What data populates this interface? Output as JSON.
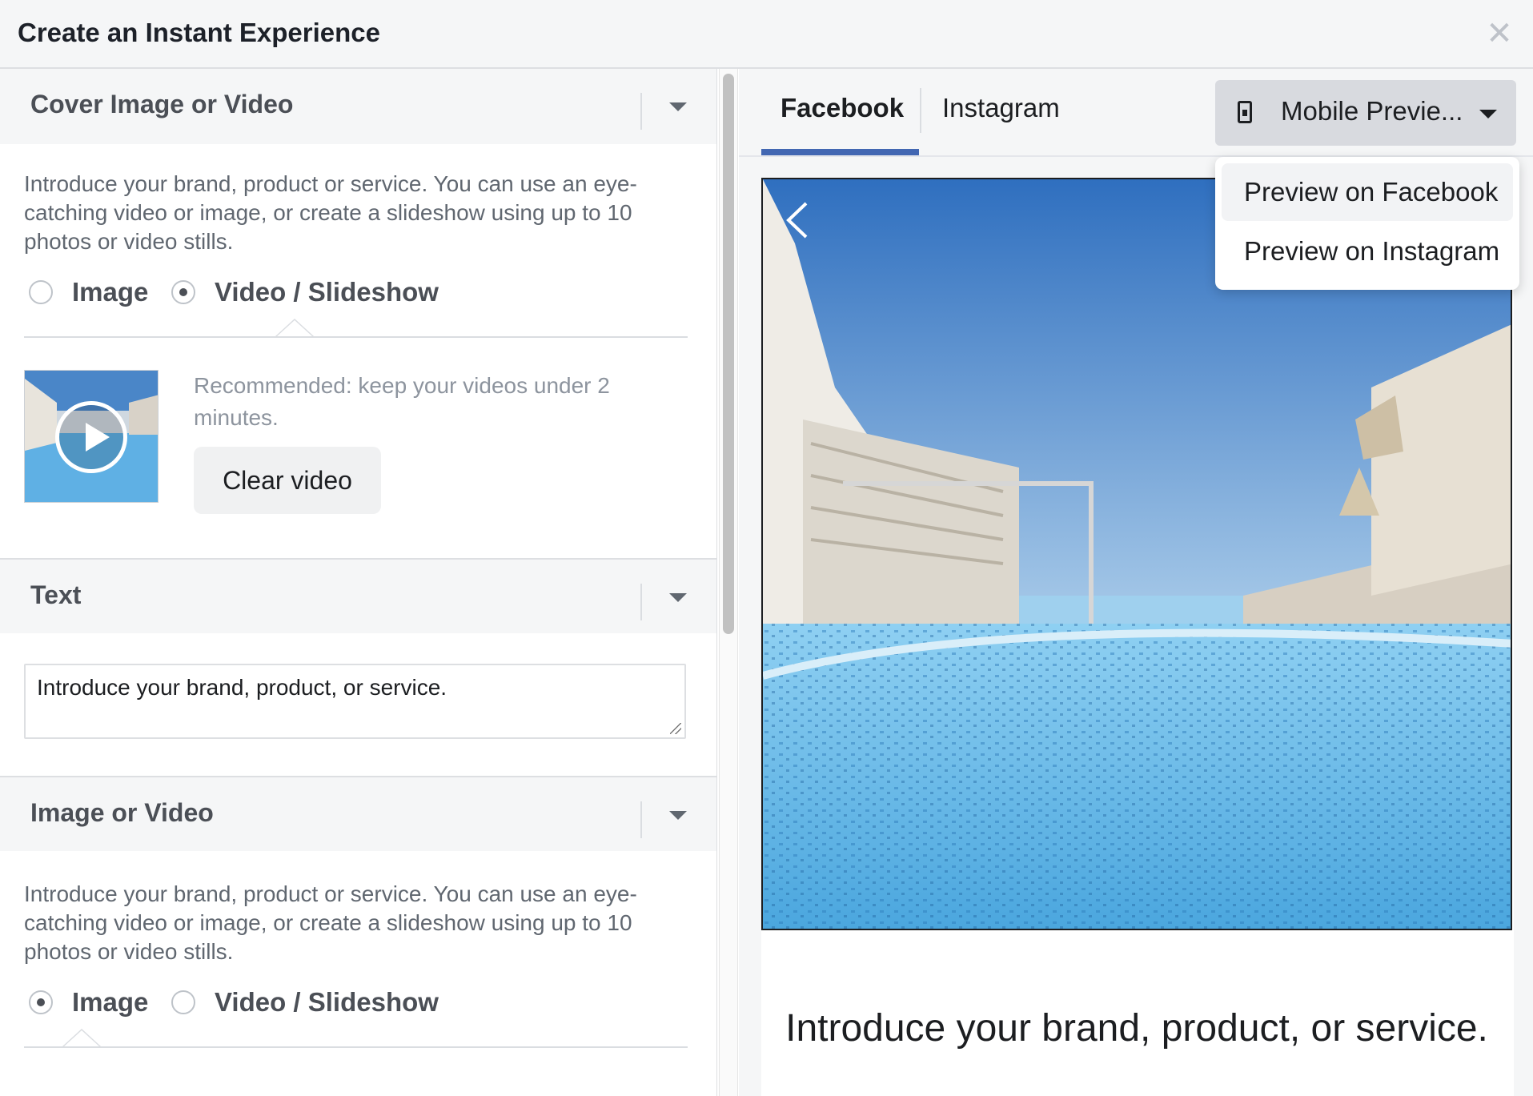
{
  "window": {
    "title": "Create an Instant Experience",
    "close_icon": "close-icon"
  },
  "left_panel": {
    "cover_section": {
      "title": "Cover Image or Video",
      "description": "Introduce your brand, product or service. You can use an eye-catching video or image, or create a slideshow using up to 10 photos or video stills.",
      "options": [
        "Image",
        "Video / Slideshow"
      ],
      "selected": "Video / Slideshow",
      "recommendation": "Recommended: keep your videos under 2 minutes.",
      "clear_button": "Clear video"
    },
    "text_section": {
      "title": "Text",
      "value": "Introduce your brand, product, or service."
    },
    "image_video_section": {
      "title": "Image or Video",
      "description": "Introduce your brand, product or service. You can use an eye-catching video or image, or create a slideshow using up to 10 photos or video stills.",
      "options": [
        "Image",
        "Video / Slideshow"
      ],
      "selected": "Image"
    }
  },
  "right_panel": {
    "tabs": [
      "Facebook",
      "Instagram"
    ],
    "active_tab": "Facebook",
    "preview_button": "Mobile Previe...",
    "dropdown": {
      "items": [
        "Preview on Facebook",
        "Preview on Instagram"
      ],
      "highlighted": "Preview on Facebook"
    },
    "card_text": "Introduce your brand, product, or service."
  },
  "colors": {
    "accent": "#4267b2",
    "header_bg": "#f5f6f7",
    "water": "#62b6e6",
    "sky": "#3f7fc4"
  }
}
